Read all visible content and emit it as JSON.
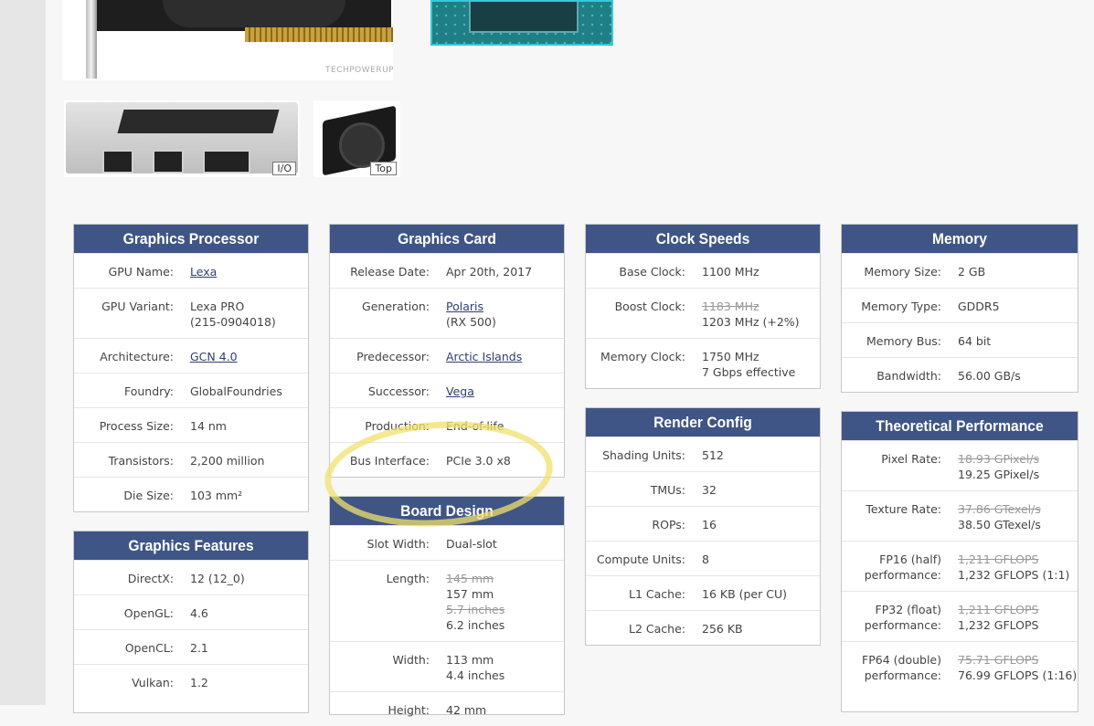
{
  "gallery": {
    "watermark": "TECHPOWERUP",
    "thumbs": [
      {
        "label": "I/O"
      },
      {
        "label": "Top"
      }
    ]
  },
  "graphics_processor": {
    "title": "Graphics Processor",
    "rows": [
      {
        "label": "GPU Name:",
        "value": "Lexa",
        "link": true
      },
      {
        "label": "GPU Variant:",
        "value": "Lexa PRO",
        "value2": "(215-0904018)"
      },
      {
        "label": "Architecture:",
        "value": "GCN 4.0",
        "link": true
      },
      {
        "label": "Foundry:",
        "value": "GlobalFoundries"
      },
      {
        "label": "Process Size:",
        "value": "14 nm"
      },
      {
        "label": "Transistors:",
        "value": "2,200 million"
      },
      {
        "label": "Die Size:",
        "value": "103 mm²"
      }
    ]
  },
  "graphics_card": {
    "title": "Graphics Card",
    "rows": [
      {
        "label": "Release Date:",
        "value": "Apr 20th, 2017"
      },
      {
        "label": "Generation:",
        "value": "Polaris",
        "value2": "(RX 500)",
        "link": true
      },
      {
        "label": "Predecessor:",
        "value": "Arctic Islands",
        "link": true
      },
      {
        "label": "Successor:",
        "value": "Vega",
        "link": true
      },
      {
        "label": "Production:",
        "value": "End-of-life"
      },
      {
        "label": "Bus Interface:",
        "value": "PCIe 3.0 x8"
      }
    ]
  },
  "board_design": {
    "title": "Board Design",
    "rows": [
      {
        "label": "Slot Width:",
        "value": "Dual-slot"
      },
      {
        "label": "Length:",
        "value_old": "145 mm",
        "value": "157 mm",
        "value_old2": "5.7 inches",
        "value2": "6.2 inches"
      },
      {
        "label": "Width:",
        "value": "113 mm",
        "value2": "4.4 inches"
      },
      {
        "label": "Height:",
        "value": "42 mm"
      }
    ]
  },
  "clock_speeds": {
    "title": "Clock Speeds",
    "rows": [
      {
        "label": "Base Clock:",
        "value": "1100 MHz"
      },
      {
        "label": "Boost Clock:",
        "value_old": "1183 MHz",
        "value": "1203 MHz (+2%)"
      },
      {
        "label": "Memory Clock:",
        "value": "1750 MHz",
        "value2": "7 Gbps effective"
      }
    ]
  },
  "render_config": {
    "title": "Render Config",
    "rows": [
      {
        "label": "Shading Units:",
        "value": "512"
      },
      {
        "label": "TMUs:",
        "value": "32"
      },
      {
        "label": "ROPs:",
        "value": "16"
      },
      {
        "label": "Compute Units:",
        "value": "8"
      },
      {
        "label": "L1 Cache:",
        "value": "16 KB (per CU)"
      },
      {
        "label": "L2 Cache:",
        "value": "256 KB"
      }
    ]
  },
  "memory": {
    "title": "Memory",
    "rows": [
      {
        "label": "Memory Size:",
        "value": "2 GB"
      },
      {
        "label": "Memory Type:",
        "value": "GDDR5"
      },
      {
        "label": "Memory Bus:",
        "value": "64 bit"
      },
      {
        "label": "Bandwidth:",
        "value": "56.00 GB/s"
      }
    ]
  },
  "theoretical_performance": {
    "title": "Theoretical Performance",
    "rows": [
      {
        "label": "Pixel Rate:",
        "value_old": "18.93 GPixel/s",
        "value": "19.25 GPixel/s"
      },
      {
        "label": "Texture Rate:",
        "value_old": "37.86 GTexel/s",
        "value": "38.50 GTexel/s"
      },
      {
        "label": "FP16 (half)",
        "label2": "performance:",
        "value_old": "1,211 GFLOPS",
        "value": "1,232 GFLOPS (1:1)"
      },
      {
        "label": "FP32 (float)",
        "label2": "performance:",
        "value_old": "1,211 GFLOPS",
        "value": "1,232 GFLOPS"
      },
      {
        "label": "FP64 (double)",
        "label2": "performance:",
        "value_old": "75.71 GFLOPS",
        "value": "76.99 GFLOPS (1:16)"
      }
    ]
  },
  "graphics_features": {
    "title": "Graphics Features",
    "rows": [
      {
        "label": "DirectX:",
        "value": "12 (12_0)"
      },
      {
        "label": "OpenGL:",
        "value": "4.6"
      },
      {
        "label": "OpenCL:",
        "value": "2.1"
      },
      {
        "label": "Vulkan:",
        "value": "1.2"
      }
    ]
  }
}
